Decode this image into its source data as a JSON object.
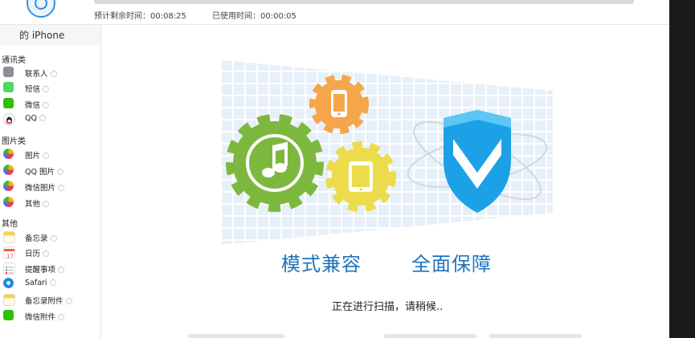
{
  "header": {
    "remaining_label": "预计剩余时间：00:08:25",
    "used_label": "已使用时间：00:00:05"
  },
  "sidebar": {
    "device_title": "的 iPhone",
    "groups": [
      {
        "title": "通讯类",
        "items": [
          {
            "label": "联系人",
            "icon": "contacts-icon"
          },
          {
            "label": "短信",
            "icon": "messages-icon"
          },
          {
            "label": "微信",
            "icon": "wechat-icon"
          },
          {
            "label": "QQ",
            "icon": "qq-icon"
          }
        ]
      },
      {
        "title": "图片类",
        "items": [
          {
            "label": "图片",
            "icon": "photos-icon"
          },
          {
            "label": "QQ 图片",
            "icon": "qq-photos-icon"
          },
          {
            "label": "微信图片",
            "icon": "wechat-photos-icon"
          },
          {
            "label": "其他",
            "icon": "other-photos-icon"
          }
        ]
      },
      {
        "title": "其他",
        "items": [
          {
            "label": "备忘录",
            "icon": "notes-icon"
          },
          {
            "label": "日历",
            "icon": "calendar-icon"
          },
          {
            "label": "提醒事项",
            "icon": "reminders-icon"
          },
          {
            "label": "Safari",
            "icon": "safari-icon"
          },
          {
            "label": "备忘录附件",
            "icon": "notes-attachments-icon"
          },
          {
            "label": "微信附件",
            "icon": "wechat-attachments-icon"
          }
        ]
      }
    ]
  },
  "main": {
    "slogan_left": "模式兼容",
    "slogan_right": "全面保障",
    "status": "正在进行扫描，请稍候.."
  },
  "colors": {
    "accent": "#1f72bd",
    "gear_green": "#7cb83e",
    "gear_orange": "#f5a64a",
    "gear_yellow": "#ecdc4c",
    "shield_blue": "#1da1e6"
  }
}
